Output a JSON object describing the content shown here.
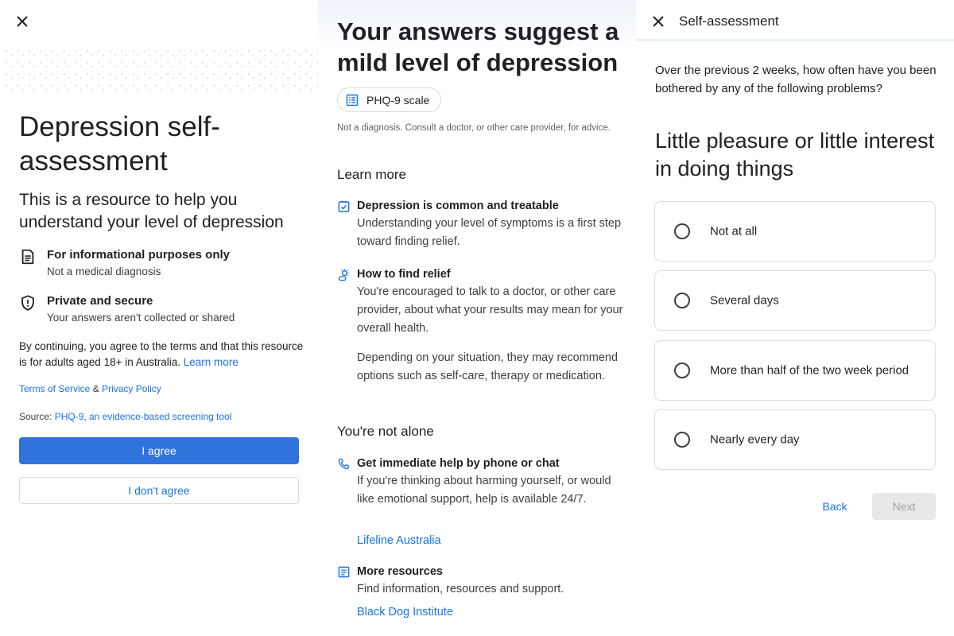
{
  "intro": {
    "close_icon": "close-icon",
    "title": "Depression self-assessment",
    "subtitle": "This is a resource to help you understand your level of depression",
    "features": [
      {
        "icon": "document-icon",
        "title": "For informational purposes only",
        "desc": "Not a medical diagnosis"
      },
      {
        "icon": "shield-icon",
        "title": "Private and secure",
        "desc": "Your answers aren't collected or shared"
      }
    ],
    "consent_text": "By continuing, you agree to the terms and that this resource is for adults aged 18+ in Australia.",
    "learn_more": "Learn more",
    "terms_link": "Terms of Service",
    "ampersand": "&",
    "privacy_link": "Privacy Policy",
    "source_label": "Source:",
    "source_link": "PHQ-9, an evidence-based screening tool",
    "agree_button": "I agree",
    "disagree_button": "I don't agree"
  },
  "results": {
    "title": "Your answers suggest a mild level of depression",
    "chip_label": "PHQ-9 scale",
    "note": "Not a diagnosis. Consult a doctor, or other care provider, for advice.",
    "learn_more_heading": "Learn more",
    "items": [
      {
        "icon": "clipboard-check-icon",
        "title": "Depression is common and treatable",
        "desc": "Understanding your level of symptoms is a first step toward finding relief."
      },
      {
        "icon": "sun-cloud-icon",
        "title": "How to find relief",
        "desc": "You're encouraged to talk to a doctor, or other care provider, about what your results may mean for your overall health.",
        "desc2": "Depending on your situation, they may recommend options such as self-care, therapy or medication."
      }
    ],
    "not_alone_heading": "You're not alone",
    "help_items": [
      {
        "icon": "phone-icon",
        "title": "Get immediate help by phone or chat",
        "desc": "If you're thinking about harming yourself, or would like emotional support, help is available 24/7.",
        "link": "Lifeline Australia"
      },
      {
        "icon": "article-icon",
        "title": "More resources",
        "desc": "Find information, resources and support.",
        "link": "Black Dog Institute"
      }
    ]
  },
  "question": {
    "header_title": "Self-assessment",
    "prompt": "Over the previous 2 weeks, how often have you been bothered by any of the following problems?",
    "item": "Little pleasure or little interest in doing things",
    "options": [
      "Not at all",
      "Several days",
      "More than half of the two week period",
      "Nearly every day"
    ],
    "selected": null,
    "back_button": "Back",
    "next_button": "Next"
  },
  "colors": {
    "accent": "#1a73e8",
    "primary_button": "#3173dd",
    "disabled_button": "#e8e8e8"
  }
}
